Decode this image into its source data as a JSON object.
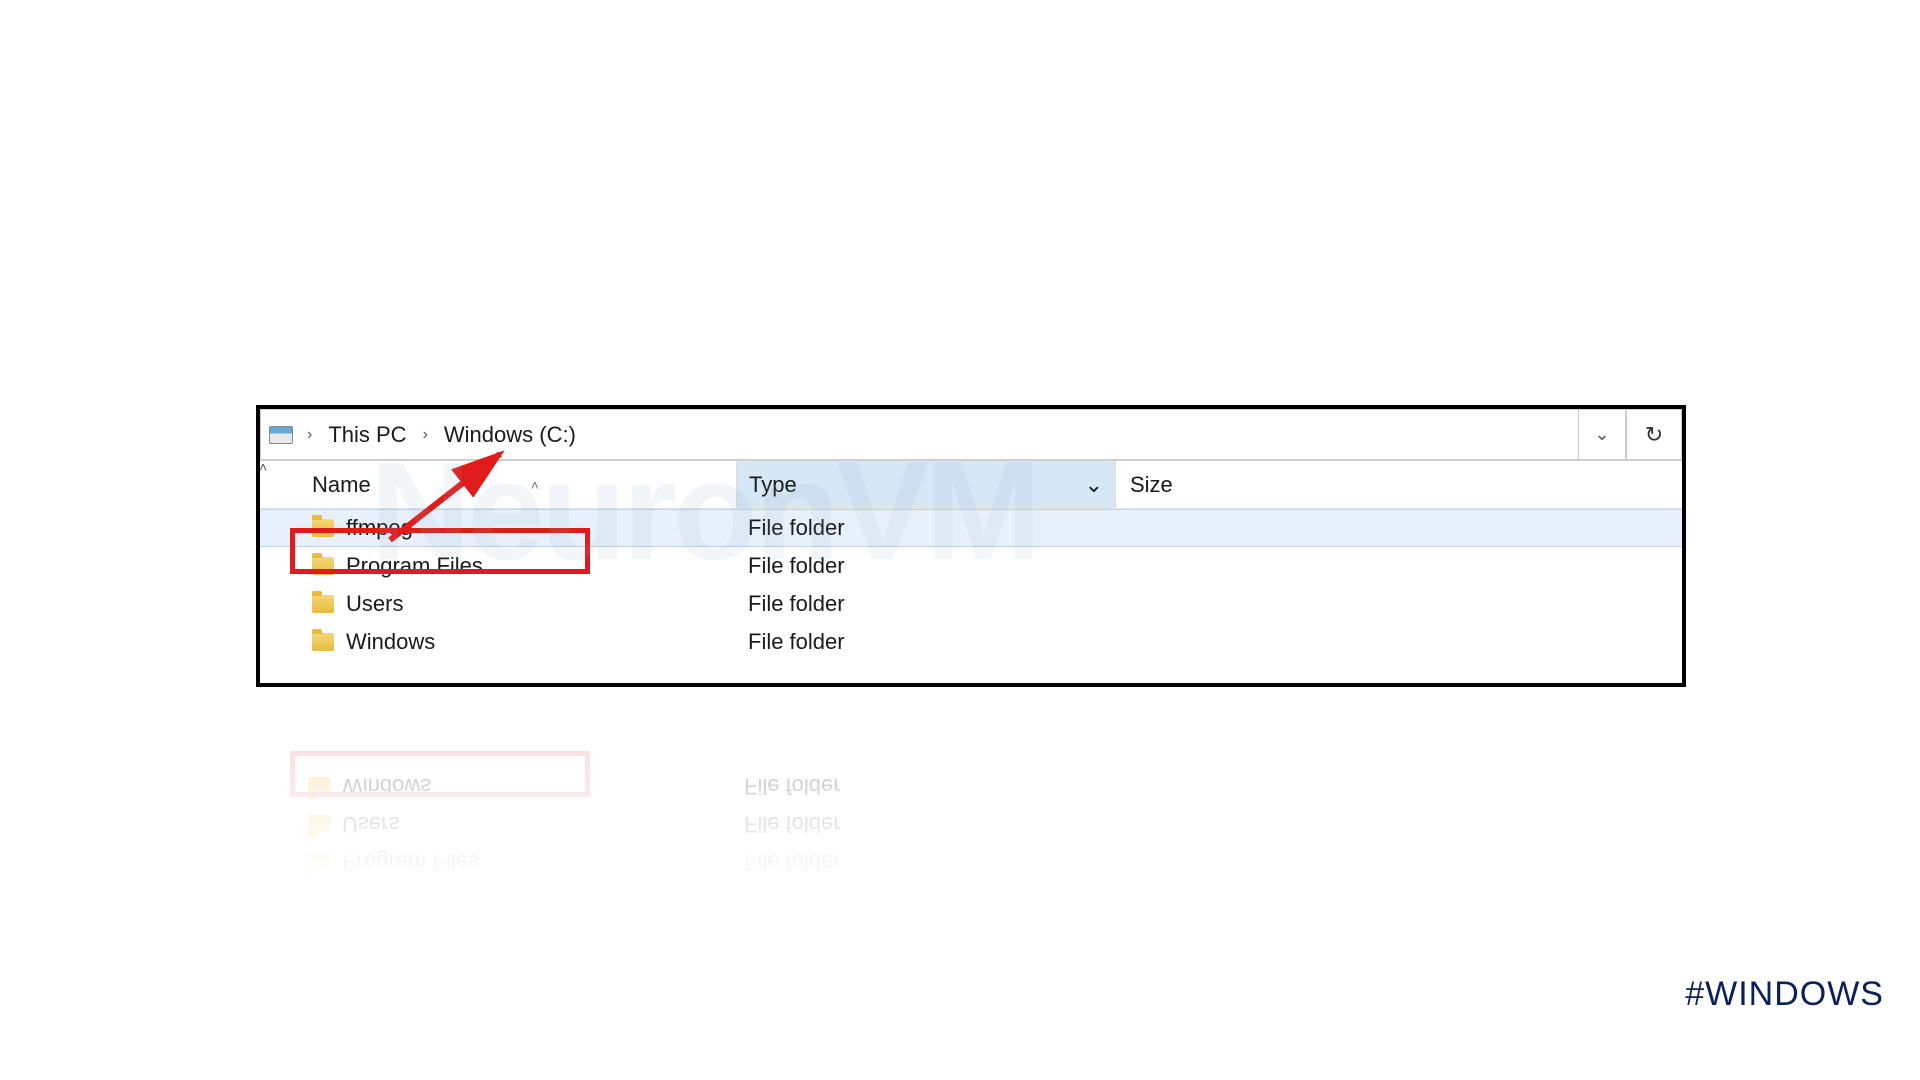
{
  "breadcrumb": {
    "root": "This PC",
    "drive": "Windows (C:)"
  },
  "columns": {
    "name": "Name",
    "type": "Type",
    "size": "Size"
  },
  "rows": [
    {
      "name": "ffmpeg",
      "type": "File folder",
      "highlighted": true,
      "selected": true
    },
    {
      "name": "Program Files",
      "type": "File folder",
      "highlighted": false,
      "selected": false
    },
    {
      "name": "Users",
      "type": "File folder",
      "highlighted": false,
      "selected": false
    },
    {
      "name": "Windows",
      "type": "File folder",
      "highlighted": false,
      "selected": false
    }
  ],
  "watermark": "NeuronVM",
  "hashtag": "#WINDOWS"
}
